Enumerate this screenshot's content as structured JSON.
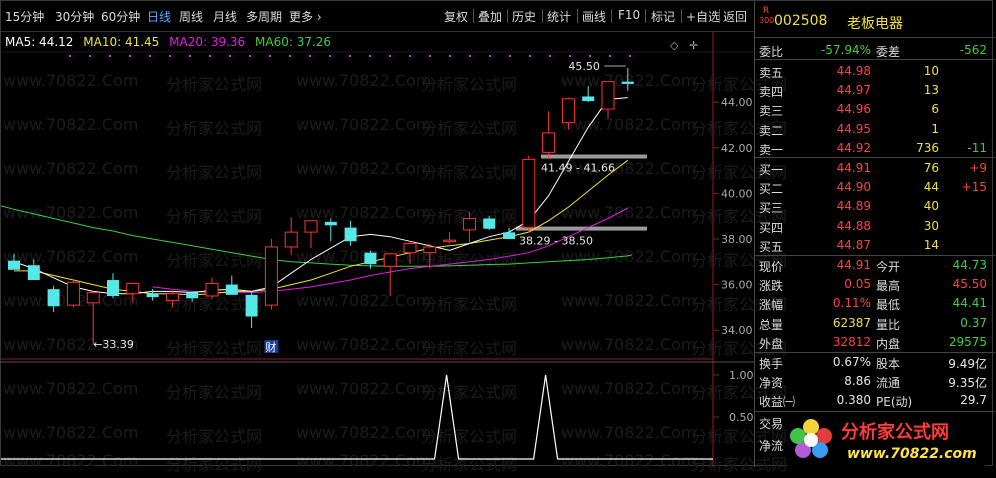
{
  "toolbar": {
    "periods": [
      "15分钟",
      "30分钟",
      "60分钟",
      "日线",
      "周线",
      "月线",
      "多周期",
      "更多 ›"
    ],
    "active_period": "日线",
    "actions": [
      "复权",
      "叠加",
      "历史",
      "统计",
      "画线",
      "F10",
      "标记",
      "+自选",
      "返回"
    ]
  },
  "ma_legend": [
    {
      "label": "MA5: 44.12",
      "color": "#ffffff"
    },
    {
      "label": "MA10: 41.45",
      "color": "#f2e03a"
    },
    {
      "label": "MA20: 39.36",
      "color": "#e020e0"
    },
    {
      "label": "MA60: 37.26",
      "color": "#3dcf3d"
    }
  ],
  "price_axis": [
    "44.00",
    "42.00",
    "40.00",
    "38.00",
    "36.00",
    "34.00"
  ],
  "volume_axis": [
    "1.00",
    "0.50"
  ],
  "annotations": {
    "high_label": "45.50",
    "low_label": "←33.39",
    "range1": "41.49 - 41.66",
    "range2": "38.29 - 38.50",
    "fin_marker": "财"
  },
  "watermarks": [
    "www.70822.Com",
    "分析家公式网"
  ],
  "chart_data": {
    "type": "candlestick",
    "ylim": [
      33.0,
      46.2
    ],
    "candles": [
      {
        "o": 37.05,
        "h": 37.35,
        "l": 36.8,
        "c": 36.65
      },
      {
        "o": 36.85,
        "h": 37.1,
        "l": 36.2,
        "c": 36.2
      },
      {
        "o": 35.8,
        "h": 35.95,
        "l": 34.8,
        "c": 35.05
      },
      {
        "o": 35.1,
        "h": 36.25,
        "l": 35.0,
        "c": 36.1
      },
      {
        "o": 35.2,
        "h": 35.7,
        "l": 33.39,
        "c": 35.65
      },
      {
        "o": 36.2,
        "h": 36.5,
        "l": 35.4,
        "c": 35.5
      },
      {
        "o": 35.6,
        "h": 36.1,
        "l": 35.2,
        "c": 36.05
      },
      {
        "o": 35.6,
        "h": 35.8,
        "l": 35.3,
        "c": 35.45
      },
      {
        "o": 35.3,
        "h": 35.7,
        "l": 35.0,
        "c": 35.6
      },
      {
        "o": 35.65,
        "h": 35.7,
        "l": 35.25,
        "c": 35.4
      },
      {
        "o": 35.5,
        "h": 36.3,
        "l": 35.4,
        "c": 36.05
      },
      {
        "o": 36.0,
        "h": 36.4,
        "l": 35.6,
        "c": 35.55
      },
      {
        "o": 35.55,
        "h": 35.7,
        "l": 34.1,
        "c": 34.6
      },
      {
        "o": 35.1,
        "h": 38.0,
        "l": 34.9,
        "c": 37.65
      },
      {
        "o": 37.65,
        "h": 38.95,
        "l": 37.3,
        "c": 38.3
      },
      {
        "o": 38.3,
        "h": 38.6,
        "l": 37.6,
        "c": 38.8
      },
      {
        "o": 38.75,
        "h": 38.9,
        "l": 37.9,
        "c": 38.6
      },
      {
        "o": 38.5,
        "h": 38.8,
        "l": 37.7,
        "c": 37.9
      },
      {
        "o": 37.4,
        "h": 37.5,
        "l": 36.7,
        "c": 36.9
      },
      {
        "o": 36.8,
        "h": 37.4,
        "l": 35.5,
        "c": 37.35
      },
      {
        "o": 37.4,
        "h": 37.9,
        "l": 36.9,
        "c": 37.8
      },
      {
        "o": 37.4,
        "h": 37.8,
        "l": 36.7,
        "c": 37.65
      },
      {
        "o": 37.95,
        "h": 38.3,
        "l": 37.8,
        "c": 37.95
      },
      {
        "o": 38.4,
        "h": 39.2,
        "l": 37.8,
        "c": 38.9
      },
      {
        "o": 38.9,
        "h": 39.0,
        "l": 38.4,
        "c": 38.45
      },
      {
        "o": 38.29,
        "h": 38.5,
        "l": 38.1,
        "c": 38.0
      },
      {
        "o": 38.5,
        "h": 41.66,
        "l": 38.29,
        "c": 41.49
      },
      {
        "o": 41.8,
        "h": 43.6,
        "l": 41.5,
        "c": 42.65
      },
      {
        "o": 43.1,
        "h": 44.2,
        "l": 42.8,
        "c": 44.15
      },
      {
        "o": 44.25,
        "h": 44.7,
        "l": 44.0,
        "c": 44.05
      },
      {
        "o": 43.7,
        "h": 44.5,
        "l": 43.3,
        "c": 44.9
      },
      {
        "o": 44.9,
        "h": 45.5,
        "l": 44.5,
        "c": 44.8
      }
    ],
    "ma5": [
      37.0,
      36.7,
      36.3,
      35.9,
      35.7,
      35.6,
      35.6,
      35.7,
      35.7,
      35.65,
      35.75,
      35.8,
      35.7,
      35.9,
      36.5,
      37.1,
      37.6,
      38.1,
      38.2,
      38.1,
      37.9,
      37.7,
      37.5,
      37.8,
      38.1,
      38.3,
      38.8,
      39.9,
      41.4,
      42.9,
      44.12,
      44.2
    ],
    "ma10": [
      36.6,
      36.6,
      36.4,
      36.2,
      36.0,
      35.8,
      35.7,
      35.6,
      35.6,
      35.55,
      35.6,
      35.7,
      35.7,
      35.8,
      36.0,
      36.2,
      36.5,
      36.8,
      37.0,
      37.2,
      37.4,
      37.6,
      37.7,
      37.8,
      37.95,
      38.1,
      38.3,
      38.8,
      39.4,
      40.1,
      40.8,
      41.45
    ],
    "ma20": [
      null,
      null,
      null,
      null,
      null,
      null,
      null,
      35.9,
      35.8,
      35.7,
      35.65,
      35.65,
      35.65,
      35.7,
      35.8,
      35.9,
      36.05,
      36.2,
      36.4,
      36.55,
      36.7,
      36.8,
      36.9,
      37.0,
      37.1,
      37.25,
      37.4,
      37.7,
      38.1,
      38.5,
      38.9,
      39.36
    ],
    "ma60": [
      39.3,
      39.1,
      38.9,
      38.7,
      38.5,
      38.35,
      38.15,
      38.0,
      37.85,
      37.7,
      37.55,
      37.4,
      37.25,
      37.1,
      37.0,
      36.95,
      36.9,
      36.85,
      36.82,
      36.8,
      36.8,
      36.8,
      36.82,
      36.85,
      36.88,
      36.9,
      36.95,
      37.0,
      37.05,
      37.1,
      37.18,
      37.26
    ],
    "volume_signal": [
      0,
      0,
      0,
      0,
      0,
      0,
      0,
      0,
      0,
      0,
      0,
      0,
      0,
      0,
      0,
      0,
      0,
      0,
      0,
      0,
      0,
      0,
      1,
      0,
      0,
      0,
      0,
      1,
      0,
      0,
      0,
      0
    ]
  },
  "stock": {
    "code": "002508",
    "name": "老板电器",
    "tag_top": "R",
    "tag_bottom": "300"
  },
  "weibi": {
    "label1": "委比",
    "value1": "-57.94%",
    "label2": "委差",
    "value2": "-562"
  },
  "asks": [
    {
      "label": "卖五",
      "price": "44.98",
      "vol": "10",
      "chg": ""
    },
    {
      "label": "卖四",
      "price": "44.97",
      "vol": "13",
      "chg": ""
    },
    {
      "label": "卖三",
      "price": "44.96",
      "vol": "6",
      "chg": ""
    },
    {
      "label": "卖二",
      "price": "44.95",
      "vol": "1",
      "chg": ""
    },
    {
      "label": "卖一",
      "price": "44.92",
      "vol": "736",
      "chg": "-11"
    }
  ],
  "bids": [
    {
      "label": "买一",
      "price": "44.91",
      "vol": "76",
      "chg": "+9"
    },
    {
      "label": "买二",
      "price": "44.90",
      "vol": "44",
      "chg": "+15"
    },
    {
      "label": "买三",
      "price": "44.89",
      "vol": "40",
      "chg": ""
    },
    {
      "label": "买四",
      "price": "44.88",
      "vol": "30",
      "chg": ""
    },
    {
      "label": "买五",
      "price": "44.87",
      "vol": "14",
      "chg": ""
    }
  ],
  "quote": [
    {
      "l1": "现价",
      "v1": "44.91",
      "c1": "red",
      "l2": "今开",
      "v2": "44.73",
      "c2": "green"
    },
    {
      "l1": "涨跌",
      "v1": "0.05",
      "c1": "red",
      "l2": "最高",
      "v2": "45.50",
      "c2": "red"
    },
    {
      "l1": "涨幅",
      "v1": "0.11%",
      "c1": "red",
      "l2": "最低",
      "v2": "44.41",
      "c2": "green"
    },
    {
      "l1": "总量",
      "v1": "62387",
      "c1": "yellow",
      "l2": "量比",
      "v2": "0.37",
      "c2": "green"
    },
    {
      "l1": "外盘",
      "v1": "32812",
      "c1": "red",
      "l2": "内盘",
      "v2": "29575",
      "c2": "green"
    }
  ],
  "stats": [
    {
      "l1": "换手",
      "v1": "0.67%",
      "l2": "股本",
      "v2": "9.49亿"
    },
    {
      "l1": "净资",
      "v1": "8.86",
      "l2": "流通",
      "v2": "9.35亿"
    },
    {
      "l1": "收益㈠",
      "v1": "0.380",
      "l2": "PE(动)",
      "v2": "29.7"
    }
  ],
  "extra_labels": [
    "交易",
    "净流"
  ],
  "logo": {
    "name": "分析家公式网",
    "url": "www.70822.com"
  }
}
